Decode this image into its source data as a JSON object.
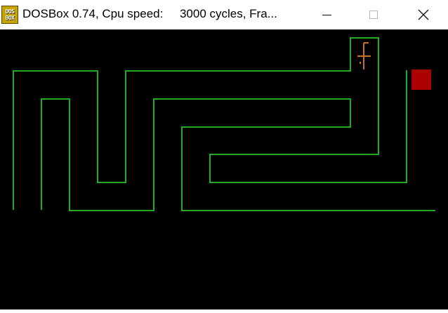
{
  "window": {
    "title": "DOSBox 0.74, Cpu speed:     3000 cycles, Fra...",
    "app_icon_lines": [
      "DOS",
      "BOX"
    ]
  },
  "game": {
    "wall_color": "#22aa22",
    "target_color": "#aa0000",
    "player_color": "#c87020",
    "player_icon": "stick-figure-icon",
    "target_icon": "red-square-icon"
  }
}
